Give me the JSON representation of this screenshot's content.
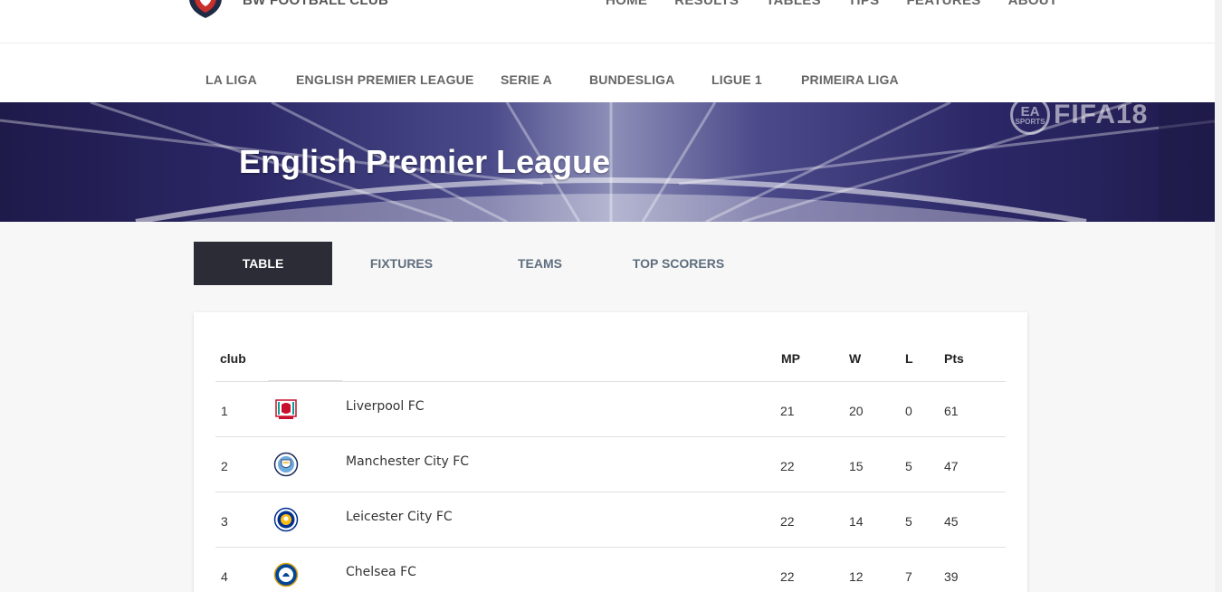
{
  "header": {
    "club_name": "BW FOOTBALL CLUB",
    "nav": [
      "HOME",
      "RESULTS",
      "TABLES",
      "TIPS",
      "FEATURES",
      "ABOUT"
    ]
  },
  "leagues": [
    "LA LIGA",
    "ENGLISH PREMIER LEAGUE",
    "SERIE A",
    "BUNDESLIGA",
    "LIGUE 1",
    "PRIMEIRA LIGA"
  ],
  "banner": {
    "title": "English Premier League",
    "watermark_ea": "EA",
    "watermark_sports": "SPORTS",
    "watermark_fifa": "FIFA18"
  },
  "tabs": [
    "TABLE",
    "FIXTURES",
    "TEAMS",
    "TOP SCORERS"
  ],
  "active_tab": "TABLE",
  "table": {
    "headers": {
      "club": "club",
      "mp": "MP",
      "w": "W",
      "l": "L",
      "pts": "Pts"
    },
    "rows": [
      {
        "pos": "1",
        "club": "Liverpool FC",
        "crest": "liverpool-crest-icon",
        "mp": "21",
        "w": "20",
        "l": "0",
        "pts": "61"
      },
      {
        "pos": "2",
        "club": "Manchester City FC",
        "crest": "manchester-city-crest-icon",
        "mp": "22",
        "w": "15",
        "l": "5",
        "pts": "47"
      },
      {
        "pos": "3",
        "club": "Leicester City FC",
        "crest": "leicester-crest-icon",
        "mp": "22",
        "w": "14",
        "l": "5",
        "pts": "45"
      },
      {
        "pos": "4",
        "club": "Chelsea FC",
        "crest": "chelsea-crest-icon",
        "mp": "22",
        "w": "12",
        "l": "7",
        "pts": "39"
      }
    ]
  },
  "colors": {
    "active_tab_bg": "#2b2c36",
    "tab_text": "#5f6e7e",
    "banner_dark": "#1e1a4a"
  }
}
